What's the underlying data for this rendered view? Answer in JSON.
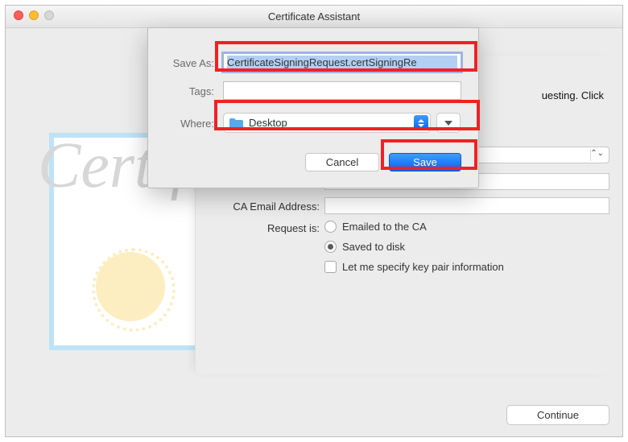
{
  "window": {
    "title": "Certificate Assistant"
  },
  "sheet": {
    "saveas_label": "Save As:",
    "saveas_value": "CertificateSigningRequest.certSigningRe",
    "tags_label": "Tags:",
    "tags_value": "",
    "where_label": "Where:",
    "where_value": "Desktop",
    "cancel": "Cancel",
    "save": "Save"
  },
  "under": {
    "partial_text_right": "uesting. Click",
    "ca_email_label": "CA Email Address:",
    "request_is_label": "Request is:",
    "option_email": "Emailed to the CA",
    "option_disk": "Saved to disk",
    "option_keypair": "Let me specify key pair information"
  },
  "footer": {
    "continue": "Continue"
  }
}
